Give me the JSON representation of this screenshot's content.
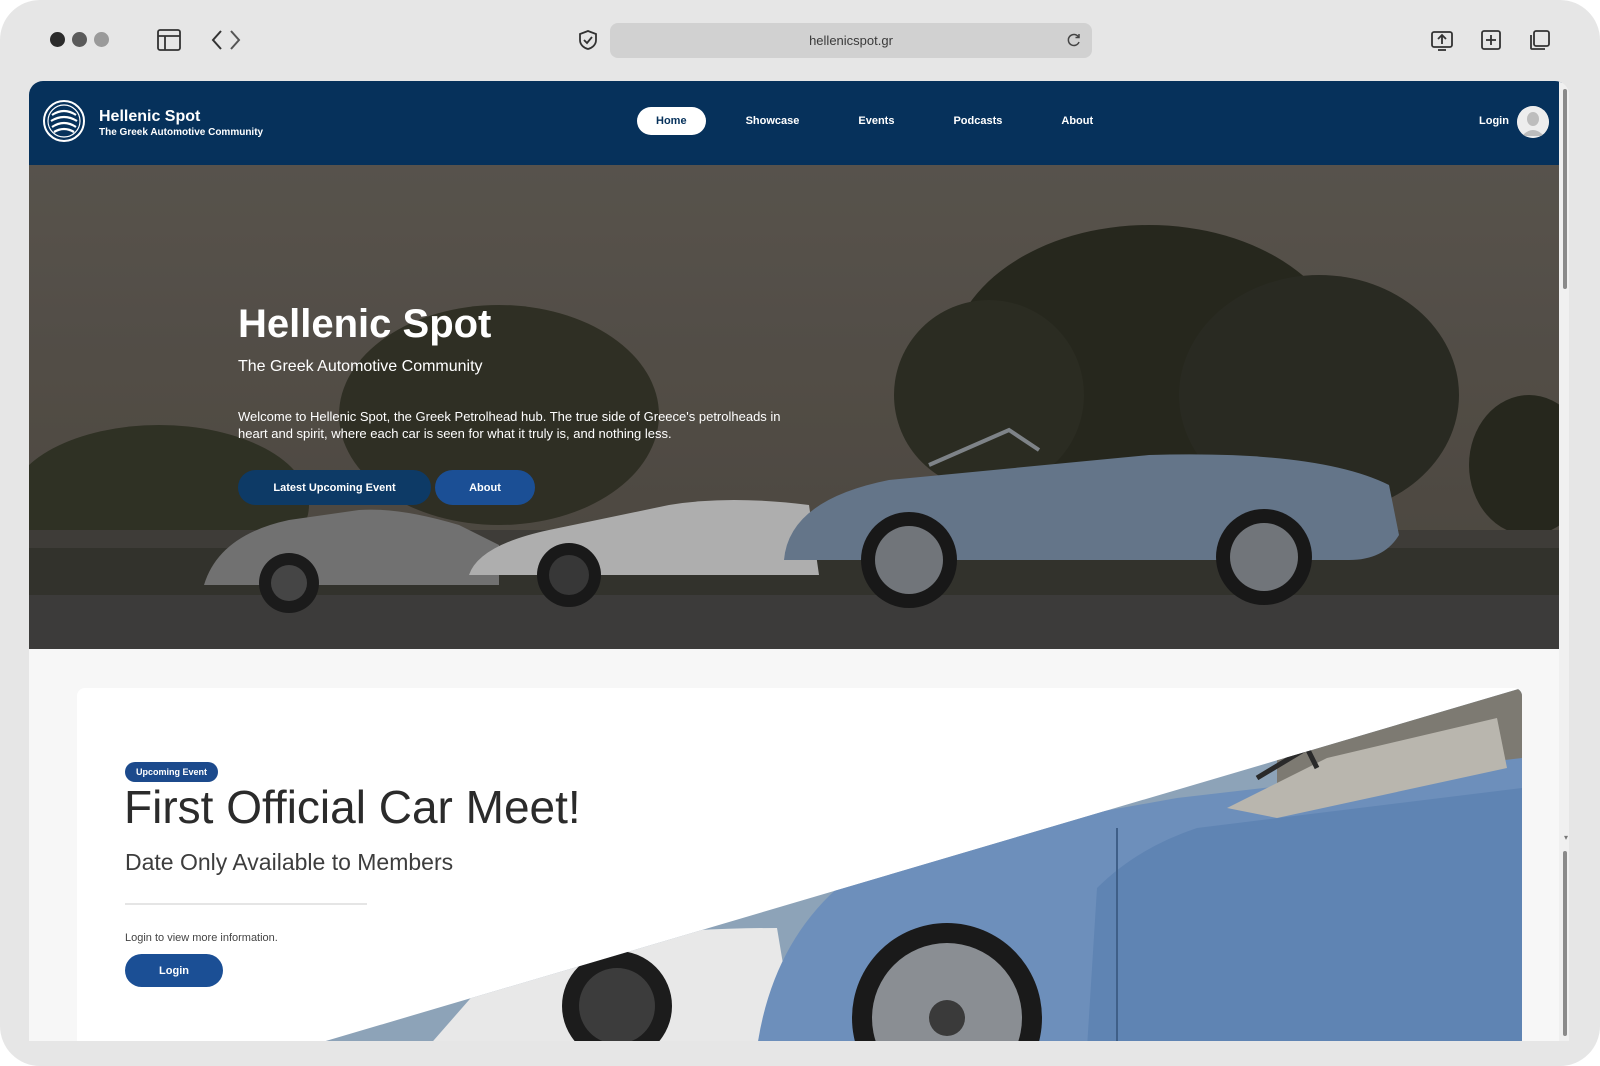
{
  "browser": {
    "url": "hellenicspot.gr"
  },
  "site": {
    "brand_title": "Hellenic Spot",
    "brand_subtitle": "The Greek Automotive Community",
    "nav": [
      {
        "label": "Home",
        "active": true
      },
      {
        "label": "Showcase",
        "active": false
      },
      {
        "label": "Events",
        "active": false
      },
      {
        "label": "Podcasts",
        "active": false
      },
      {
        "label": "About",
        "active": false
      }
    ],
    "login_label": "Login"
  },
  "hero": {
    "title": "Hellenic Spot",
    "subtitle": "The Greek Automotive Community",
    "text": "Welcome to Hellenic Spot, the Greek Petrolhead hub. The true side of Greece's petrolheads in heart and spirit, where each car is seen for what it truly is, and nothing less.",
    "primary_button": "Latest Upcoming Event",
    "secondary_button": "About"
  },
  "event": {
    "badge": "Upcoming Event",
    "title": "First Official Car Meet!",
    "subtitle": "Date Only Available to Members",
    "info": "Login to view more information.",
    "login_button": "Login"
  },
  "colors": {
    "navy": "#06315b",
    "button_dark": "#0d3a66",
    "button_blue": "#1b4f95",
    "badge": "#1c4a8c"
  }
}
